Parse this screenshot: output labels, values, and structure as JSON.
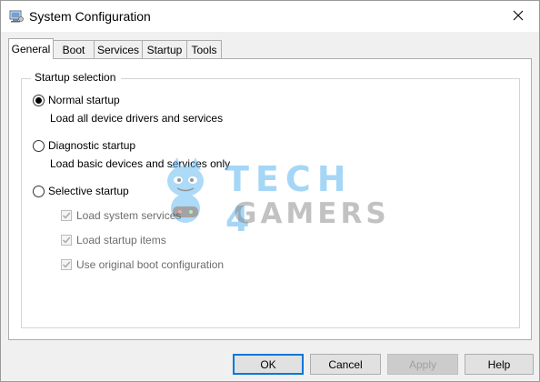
{
  "window": {
    "title": "System Configuration",
    "icon": "system-config-icon"
  },
  "tabs": [
    {
      "label": "General",
      "active": true
    },
    {
      "label": "Boot",
      "active": false
    },
    {
      "label": "Services",
      "active": false
    },
    {
      "label": "Startup",
      "active": false
    },
    {
      "label": "Tools",
      "active": false
    }
  ],
  "startup_selection": {
    "label": "Startup selection",
    "normal": {
      "label": "Normal startup",
      "description": "Load all device drivers and services",
      "selected": true
    },
    "diagnostic": {
      "label": "Diagnostic startup",
      "description": "Load basic devices and services only",
      "selected": false
    },
    "selective": {
      "label": "Selective startup",
      "selected": false,
      "options": [
        {
          "label": "Load system services",
          "checked": true,
          "enabled": false
        },
        {
          "label": "Load startup items",
          "checked": true,
          "enabled": false
        },
        {
          "label": "Use original boot configuration",
          "checked": true,
          "enabled": false
        }
      ]
    }
  },
  "watermark": {
    "line1": "TECH 4",
    "line2": "GAMERS"
  },
  "buttons": {
    "ok": "OK",
    "cancel": "Cancel",
    "apply": "Apply",
    "help": "Help"
  },
  "colors": {
    "accent": "#0078d7",
    "watermark_blue": "#5cb6f0",
    "watermark_gray": "#7a7a7a"
  }
}
